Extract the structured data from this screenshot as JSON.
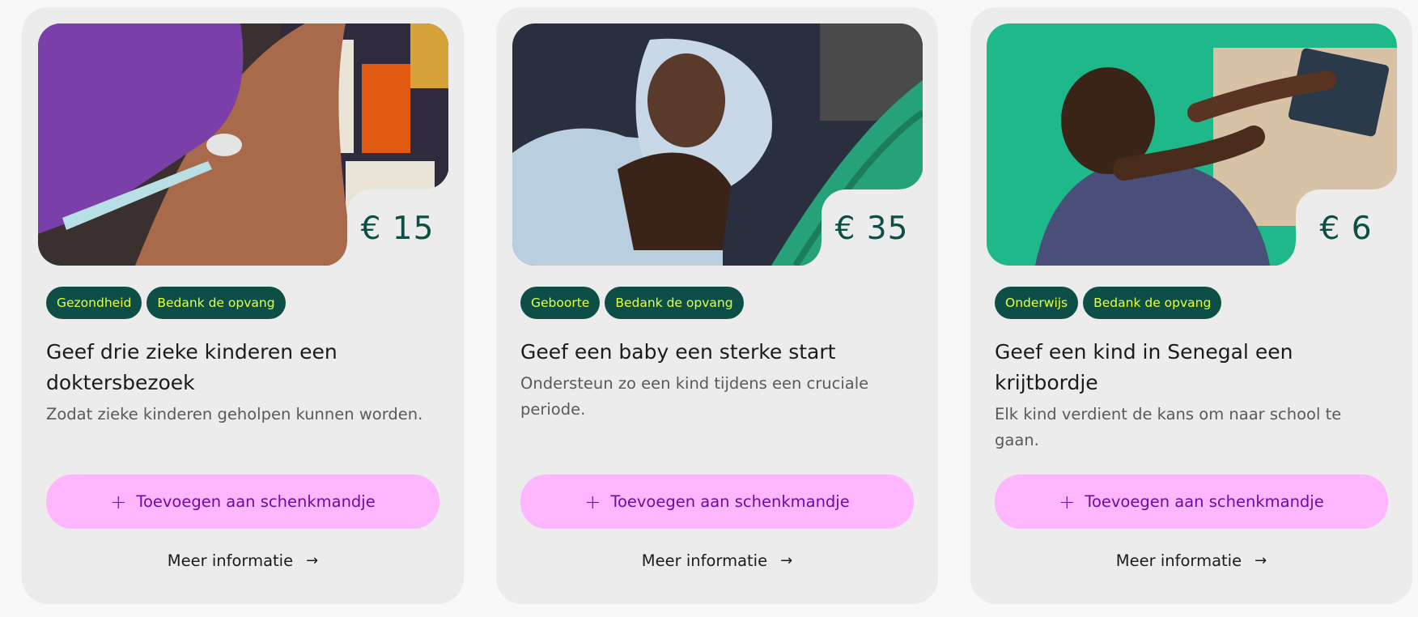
{
  "cards": [
    {
      "price": "€ 15",
      "tags": [
        "Gezondheid",
        "Bedank de opvang"
      ],
      "title": "Geef drie zieke kinderen een doktersbezoek",
      "description": "Zodat zieke kinderen geholpen kunnen worden.",
      "add_label": "Toevoegen aan schenkmandje",
      "more_label": "Meer informatie"
    },
    {
      "price": "€ 35",
      "tags": [
        "Geboorte",
        "Bedank de opvang"
      ],
      "title": "Geef een baby een sterke start",
      "description": "Ondersteun zo een kind tijdens een cruciale periode.",
      "add_label": "Toevoegen aan schenkmandje",
      "more_label": "Meer informatie"
    },
    {
      "price": "€ 6",
      "tags": [
        "Onderwijs",
        "Bedank de opvang"
      ],
      "title": "Geef een kind in Senegal een krijtbordje",
      "description": "Elk kind verdient de kans om naar school te gaan.",
      "add_label": "Toevoegen aan schenkmandje",
      "more_label": "Meer informatie"
    }
  ],
  "icons": {
    "add": "plus-icon",
    "more": "arrow-right-icon"
  },
  "colors": {
    "card_bg": "#ececec",
    "price": "#0d4f46",
    "tag_bg": "#0d4f46",
    "tag_text": "#e5ff3d",
    "button_bg": "#feb6fe",
    "button_text": "#6b0ba8"
  }
}
